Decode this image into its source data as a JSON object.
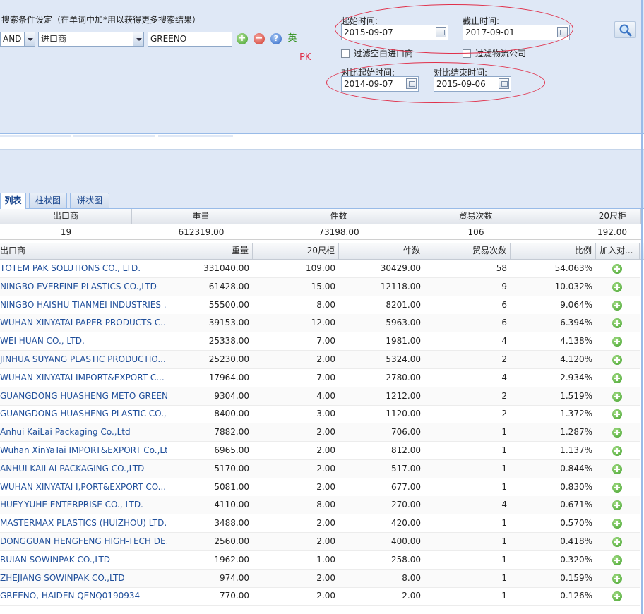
{
  "search": {
    "title": "搜索条件设定（在单词中加*用以获得更多搜索结果）",
    "logic_value": "AND",
    "field_value": "进口商",
    "keyword_value": "GREENO",
    "lang_label": "英",
    "pk_label": "PK"
  },
  "dates": {
    "start_label": "起始时间:",
    "start_value": "2015-09-07",
    "end_label": "截止时间:",
    "end_value": "2017-09-01",
    "filter_empty_importer": "过滤空白进口商",
    "filter_logistics": "过滤物流公司",
    "compare_start_label": "对比起始时间:",
    "compare_start_value": "2014-09-07",
    "compare_end_label": "对比结束时间:",
    "compare_end_value": "2015-09-06"
  },
  "tabs": [
    {
      "label": "列表"
    },
    {
      "label": "柱状图"
    },
    {
      "label": "饼状图"
    }
  ],
  "summary": {
    "headers": [
      "出口商",
      "重量",
      "件数",
      "贸易次数",
      "20尺柜"
    ],
    "values": [
      "19",
      "612319.00",
      "73198.00",
      "106",
      "192.00"
    ]
  },
  "grid": {
    "headers": [
      "出口商",
      "重量",
      "20尺柜",
      "件数",
      "贸易次数",
      "比例",
      "加入对..."
    ],
    "rows": [
      {
        "name": "TOTEM PAK SOLUTIONS CO., LTD.",
        "weight": "331040.00",
        "teu": "109.00",
        "pieces": "30429.00",
        "trades": "58",
        "ratio": "54.063%"
      },
      {
        "name": "NINGBO EVERFINE PLASTICS CO.,LTD",
        "weight": "61428.00",
        "teu": "15.00",
        "pieces": "12118.00",
        "trades": "9",
        "ratio": "10.032%"
      },
      {
        "name": "NINGBO HAISHU TIANMEI INDUSTRIES ...",
        "weight": "55500.00",
        "teu": "8.00",
        "pieces": "8201.00",
        "trades": "6",
        "ratio": "9.064%"
      },
      {
        "name": "WUHAN XINYATAI PAPER PRODUCTS C...",
        "weight": "39153.00",
        "teu": "12.00",
        "pieces": "5963.00",
        "trades": "6",
        "ratio": "6.394%"
      },
      {
        "name": "WEI HUAN CO., LTD.",
        "weight": "25338.00",
        "teu": "7.00",
        "pieces": "1981.00",
        "trades": "4",
        "ratio": "4.138%"
      },
      {
        "name": "JINHUA SUYANG PLASTIC PRODUCTIO...",
        "weight": "25230.00",
        "teu": "2.00",
        "pieces": "5324.00",
        "trades": "2",
        "ratio": "4.120%"
      },
      {
        "name": "WUHAN XINYATAI IMPORT&EXPORT C...",
        "weight": "17964.00",
        "teu": "7.00",
        "pieces": "2780.00",
        "trades": "4",
        "ratio": "2.934%"
      },
      {
        "name": "GUANGDONG HUASHENG METO GREEN...",
        "weight": "9304.00",
        "teu": "4.00",
        "pieces": "1212.00",
        "trades": "2",
        "ratio": "1.519%"
      },
      {
        "name": "GUANGDONG HUASHENG PLASTIC CO.,...",
        "weight": "8400.00",
        "teu": "3.00",
        "pieces": "1120.00",
        "trades": "2",
        "ratio": "1.372%"
      },
      {
        "name": "Anhui KaiLai Packaging Co.,Ltd",
        "weight": "7882.00",
        "teu": "2.00",
        "pieces": "706.00",
        "trades": "1",
        "ratio": "1.287%"
      },
      {
        "name": "Wuhan XinYaTai IMPORT&EXPORT Co.,Lt",
        "weight": "6965.00",
        "teu": "2.00",
        "pieces": "812.00",
        "trades": "1",
        "ratio": "1.137%"
      },
      {
        "name": "ANHUI KAILAI PACKAGING CO.,LTD",
        "weight": "5170.00",
        "teu": "2.00",
        "pieces": "517.00",
        "trades": "1",
        "ratio": "0.844%"
      },
      {
        "name": "WUHAN XINYATAI I,PORT&EXPORT CO...",
        "weight": "5081.00",
        "teu": "2.00",
        "pieces": "677.00",
        "trades": "1",
        "ratio": "0.830%"
      },
      {
        "name": "HUEY-YUHE ENTERPRISE CO., LTD.",
        "weight": "4110.00",
        "teu": "8.00",
        "pieces": "270.00",
        "trades": "4",
        "ratio": "0.671%"
      },
      {
        "name": "MASTERMAX PLASTICS (HUIZHOU) LTD.",
        "weight": "3488.00",
        "teu": "2.00",
        "pieces": "420.00",
        "trades": "1",
        "ratio": "0.570%"
      },
      {
        "name": "DONGGUAN HENGFENG HIGH-TECH DE...",
        "weight": "2560.00",
        "teu": "2.00",
        "pieces": "400.00",
        "trades": "1",
        "ratio": "0.418%"
      },
      {
        "name": "RUIAN SOWINPAK CO.,LTD",
        "weight": "1962.00",
        "teu": "1.00",
        "pieces": "258.00",
        "trades": "1",
        "ratio": "0.320%"
      },
      {
        "name": "ZHEJIANG SOWINPAK CO.,LTD",
        "weight": "974.00",
        "teu": "2.00",
        "pieces": "8.00",
        "trades": "1",
        "ratio": "0.159%"
      },
      {
        "name": "GREENO, HAIDEN QENQ0190934",
        "weight": "770.00",
        "teu": "2.00",
        "pieces": "2.00",
        "trades": "1",
        "ratio": "0.126%"
      }
    ]
  },
  "icons": {
    "add": "plus-circle-icon",
    "remove": "minus-circle-icon",
    "help": "question-circle-icon",
    "search": "magnifier-icon",
    "calendar": "calendar-icon"
  },
  "colors": {
    "panel_bg": "#dfe8f6",
    "link_text": "#1f4e9a",
    "annotation_red": "#e0304a",
    "add_green": "#3f9f2a"
  }
}
